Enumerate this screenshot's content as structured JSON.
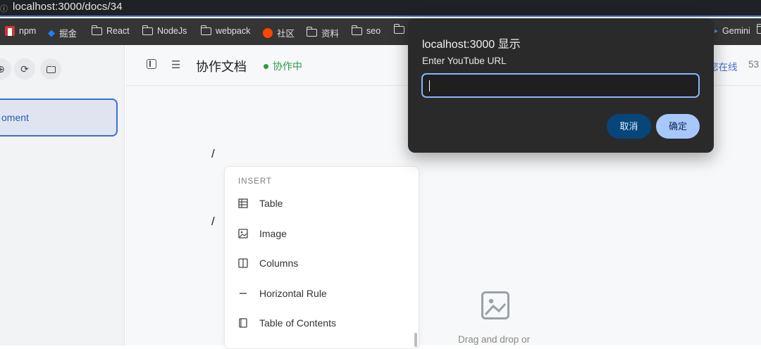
{
  "browser": {
    "url": "localhost:3000/docs/34",
    "bookmarks": [
      {
        "label": "npm"
      },
      {
        "label": "掘金"
      },
      {
        "label": "React"
      },
      {
        "label": "NodeJs"
      },
      {
        "label": "webpack"
      },
      {
        "label": "社区"
      },
      {
        "label": "资料"
      },
      {
        "label": "seo"
      },
      {
        "label": "Gemini"
      }
    ]
  },
  "sidebar": {
    "doc_card": "oment"
  },
  "toolbar": {
    "title": "协作文档",
    "status": "协作中",
    "online": "您在线",
    "count": "53"
  },
  "editor": {
    "slash1": "/",
    "slash2": "/"
  },
  "insert_menu": {
    "header": "INSERT",
    "items": [
      {
        "label": "Table",
        "icon": "table-icon"
      },
      {
        "label": "Image",
        "icon": "image-icon"
      },
      {
        "label": "Columns",
        "icon": "columns-icon"
      },
      {
        "label": "Horizontal Rule",
        "icon": "horizontal-rule-icon"
      },
      {
        "label": "Table of Contents",
        "icon": "book-icon"
      }
    ]
  },
  "upload": {
    "hint": "Drag and drop or"
  },
  "dialog": {
    "title": "localhost:3000 显示",
    "message": "Enter YouTube URL",
    "input_value": "",
    "cancel": "取消",
    "ok": "确定"
  },
  "colors": {
    "accent": "#3b6fd0",
    "dialog_bg": "#2a2a2b",
    "ok_button": "#a8c7fa",
    "cancel_button": "#06467a",
    "status_green": "#2b9a47"
  }
}
